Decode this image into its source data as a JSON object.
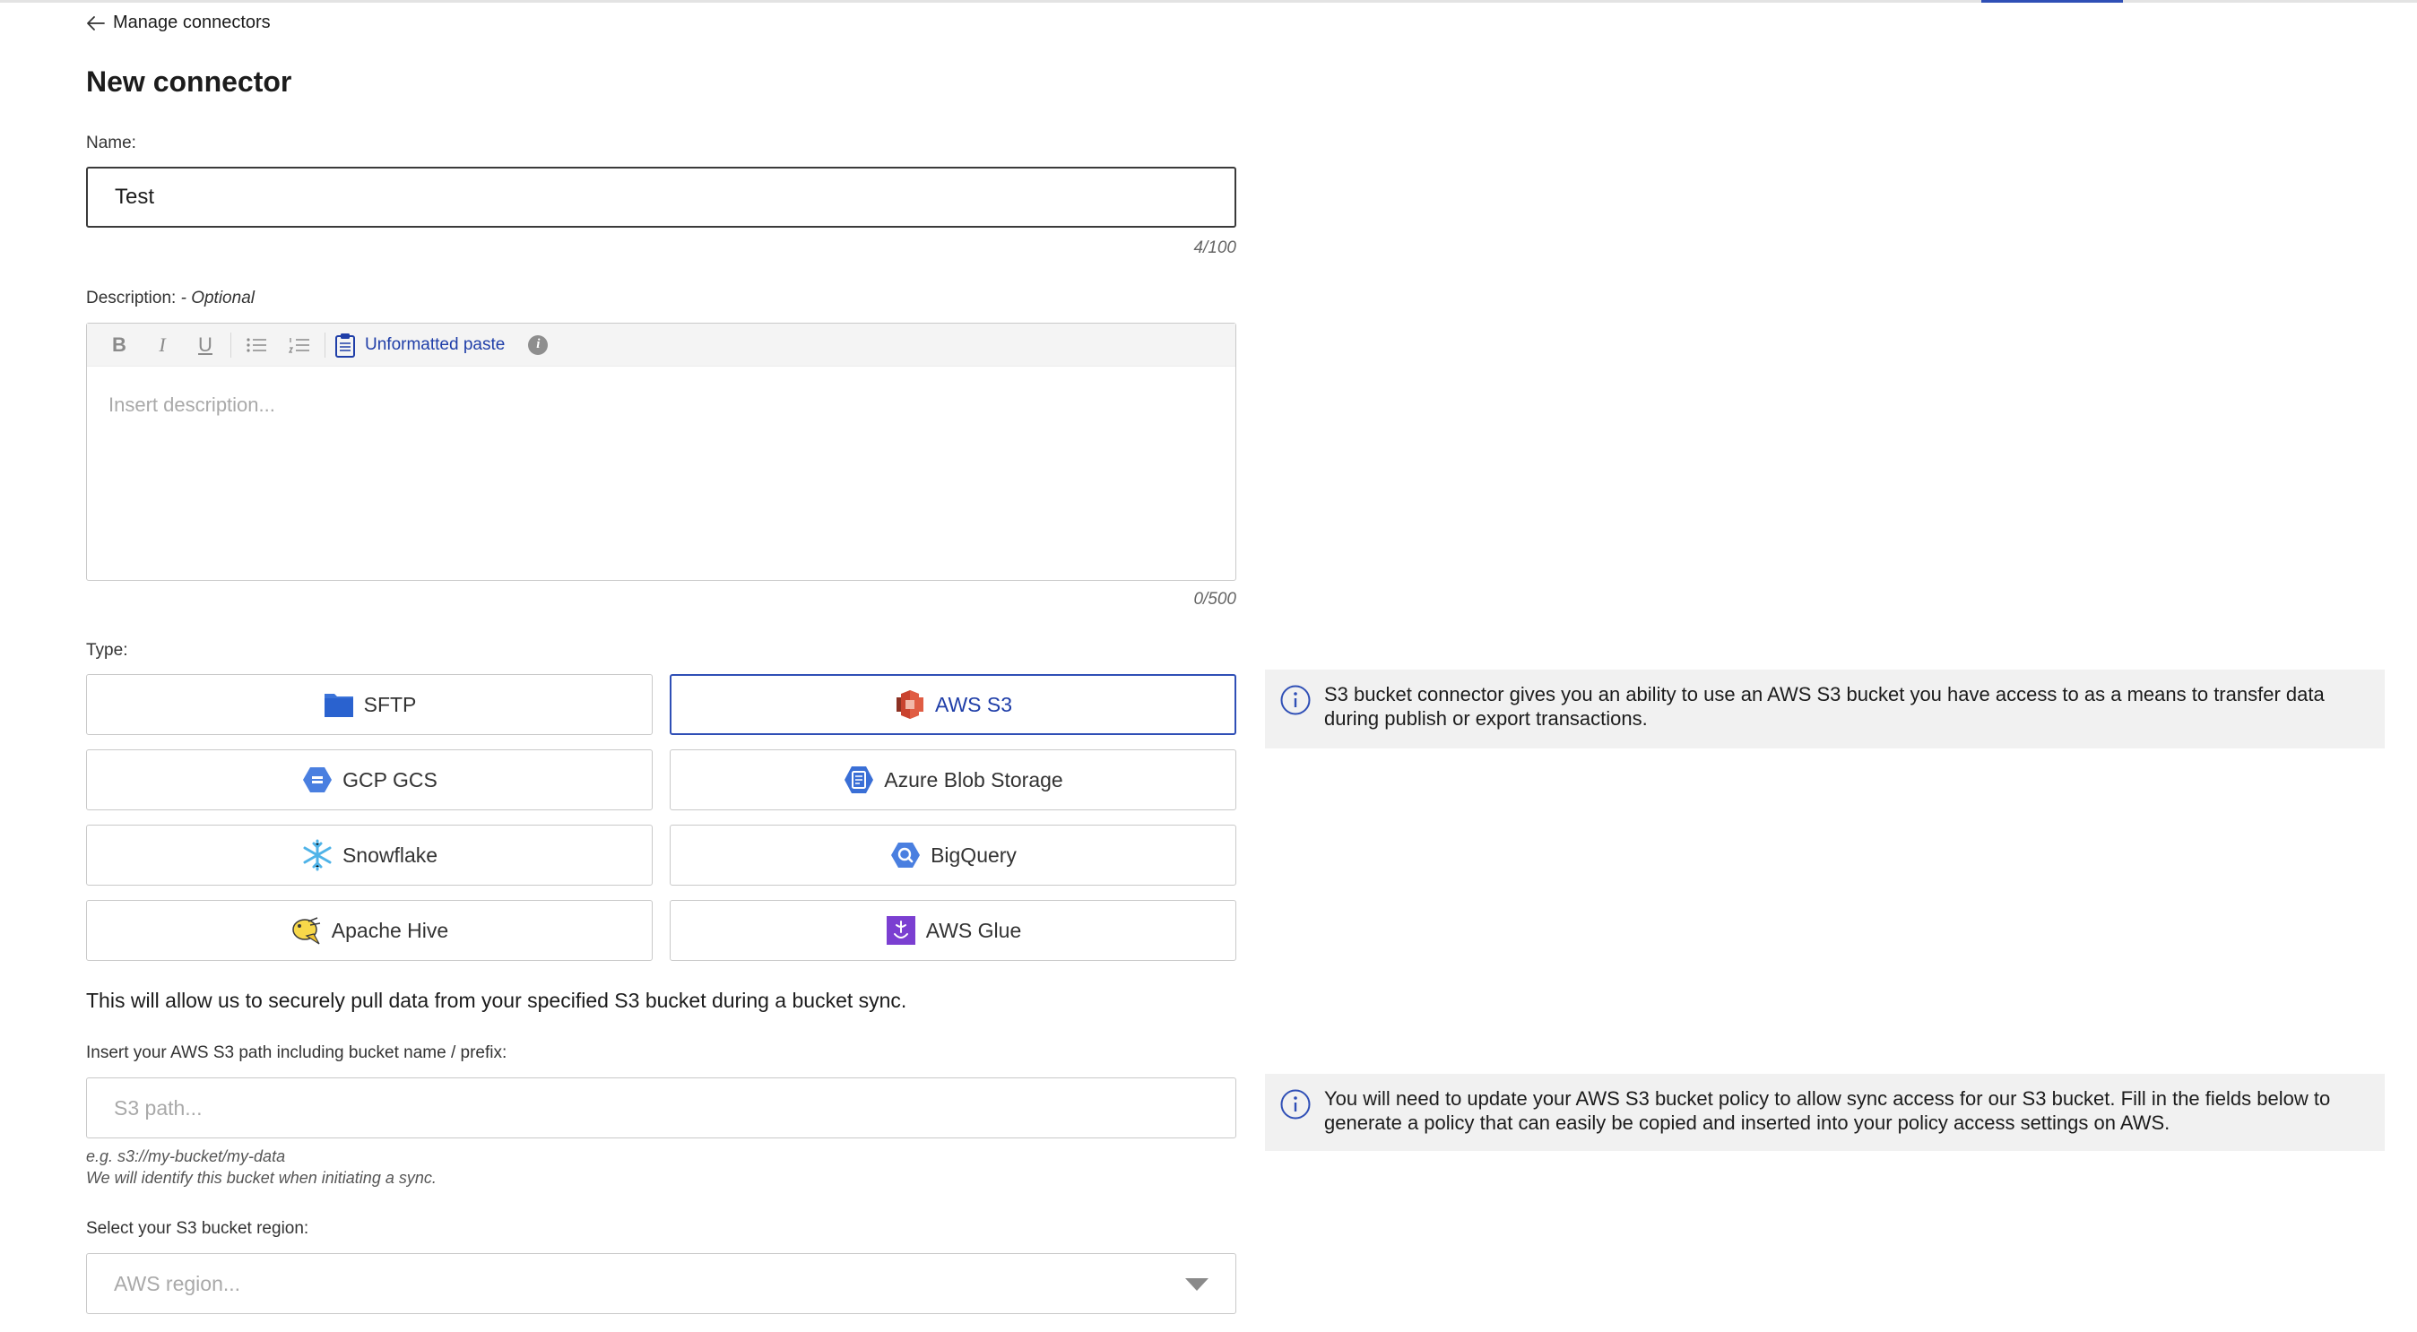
{
  "nav": {
    "back_label": "Manage connectors"
  },
  "page": {
    "title": "New connector"
  },
  "name": {
    "label": "Name:",
    "value": "Test",
    "counter": "4/100"
  },
  "description": {
    "label": "Description:",
    "optional": " - Optional",
    "placeholder": "Insert description...",
    "counter": "0/500",
    "toolbar": {
      "bold": "B",
      "italic": "I",
      "underline": "U",
      "paste_label": "Unformatted paste",
      "info": "i"
    }
  },
  "type": {
    "label": "Type:",
    "options": [
      {
        "label": "SFTP",
        "icon": "folder-icon",
        "selected": false
      },
      {
        "label": "AWS S3",
        "icon": "aws-s3-icon",
        "selected": true
      },
      {
        "label": "GCP GCS",
        "icon": "gcp-gcs-icon",
        "selected": false
      },
      {
        "label": "Azure Blob Storage",
        "icon": "azure-blob-icon",
        "selected": false
      },
      {
        "label": "Snowflake",
        "icon": "snowflake-icon",
        "selected": false
      },
      {
        "label": "BigQuery",
        "icon": "bigquery-icon",
        "selected": false
      },
      {
        "label": "Apache Hive",
        "icon": "apache-hive-icon",
        "selected": false
      },
      {
        "label": "AWS Glue",
        "icon": "aws-glue-icon",
        "selected": false
      }
    ]
  },
  "info": {
    "s3_connector": "S3 bucket connector gives you an ability to use an AWS S3 bucket you have access to as a means to transfer data during publish or export transactions.",
    "policy": "You will need to update your AWS S3 bucket policy to allow sync access for our S3 bucket. Fill in the fields below to generate a policy that can easily be copied and inserted into your policy access settings on AWS."
  },
  "allow_text": "This will allow us to securely pull data from your specified S3 bucket during a bucket sync.",
  "s3_path": {
    "label": "Insert your AWS S3 path including bucket name / prefix:",
    "placeholder": "S3 path...",
    "hint_example": "e.g. s3://my-bucket/my-data",
    "hint_identify": "We will identify this bucket when initiating a sync."
  },
  "region": {
    "label": "Select your S3 bucket region:",
    "placeholder": "AWS region..."
  },
  "colors": {
    "accent": "#2f4fb6",
    "link": "#1f3ea8",
    "info_bg": "#f1f1f1",
    "border": "#c9c9c9"
  }
}
